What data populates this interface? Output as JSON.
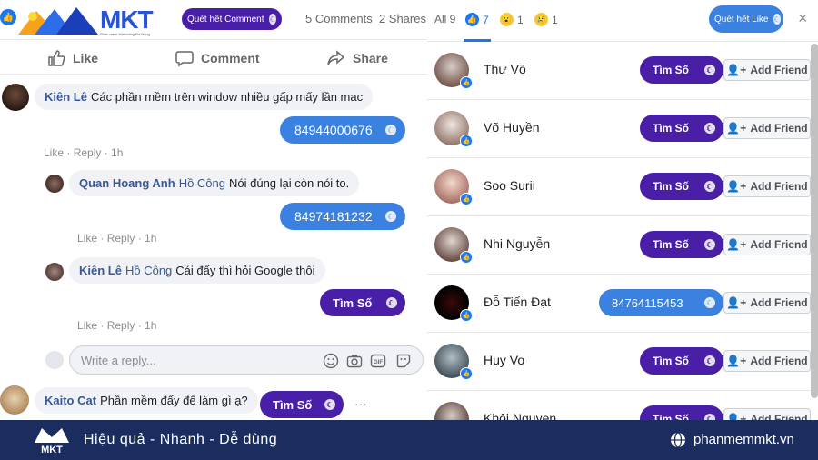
{
  "header": {
    "brand": "MKT",
    "brand_sub": "Phần mềm Marketing Đa Năng",
    "scan_comment_label": "Quét hết Comment",
    "comments_count": "5 Comments",
    "shares_count": "2 Shares"
  },
  "actions": {
    "like": "Like",
    "comment": "Comment",
    "share": "Share"
  },
  "comments": [
    {
      "author": "Kiên Lê",
      "text": "Các phần mềm trên window nhiều gấp mấy lần mac",
      "result": "84944000676",
      "like": "Like",
      "reply": "Reply",
      "time": "1h"
    },
    {
      "author": "Quan Hoang Anh",
      "mention": "Hồ Công",
      "text": "Nói đúng lại còn nói to.",
      "result": "84974181232",
      "like": "Like",
      "reply": "Reply",
      "time": "1h"
    },
    {
      "author": "Kiên Lê",
      "mention": "Hồ Công",
      "text": "Cái đấy thì hỏi Google thôi",
      "result": "Tìm Số",
      "like": "Like",
      "reply": "Reply",
      "time": "1h"
    },
    {
      "author": "Kaito Cat",
      "text": "Phần mềm đấy để làm gì ạ?",
      "result": "Tìm Số"
    }
  ],
  "reply_box": {
    "placeholder": "Write a reply..."
  },
  "reactions": {
    "all_label": "All 9",
    "like_count": "7",
    "wow_count": "1",
    "sad_count": "1",
    "scan_like_label": "Quét hết Like",
    "close": "×"
  },
  "likers": [
    {
      "name": "Thư Võ",
      "action": "Tìm Số"
    },
    {
      "name": "Võ Huyền",
      "action": "Tìm Số"
    },
    {
      "name": "Soo Surii",
      "action": "Tìm Số"
    },
    {
      "name": "Nhi Nguyễn",
      "action": "Tìm Số"
    },
    {
      "name": "Đỗ Tiến Đạt",
      "phone": "84764115453"
    },
    {
      "name": "Huy Vo",
      "action": "Tìm Số"
    },
    {
      "name": "Khôi Nguyen",
      "action": "Tìm Số"
    }
  ],
  "add_friend_label": "Add Friend",
  "footer": {
    "logo": "MKT",
    "tagline": "Hiệu quả - Nhanh - Dễ dùng",
    "site": "phanmemmkt.vn"
  },
  "colors": {
    "purple_pill": "#4a1fa8",
    "blue_pill": "#3b82e0",
    "footer_bg": "#1a2d5e",
    "fb_blue": "#1877f2"
  }
}
